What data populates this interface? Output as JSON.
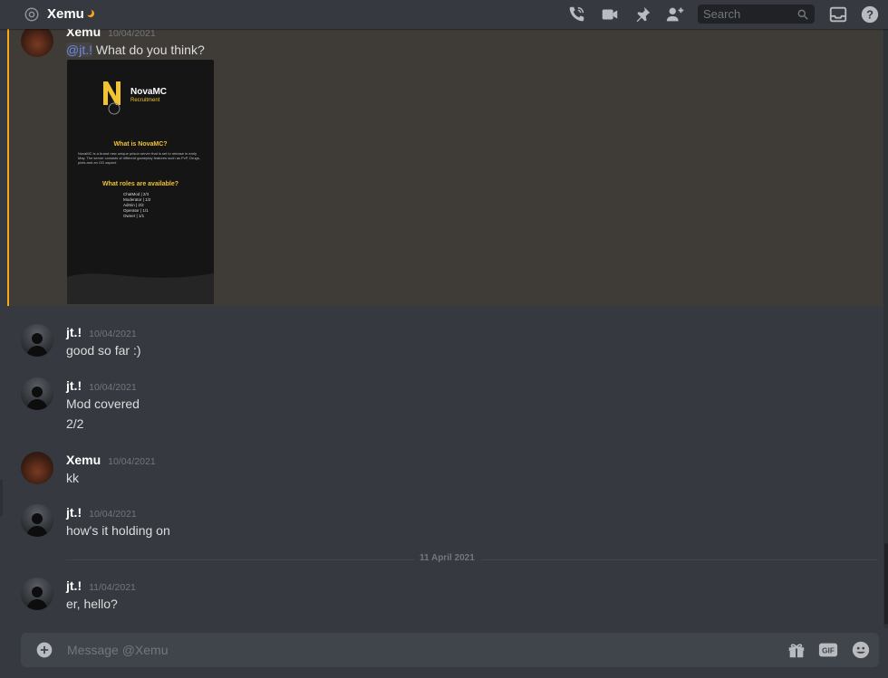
{
  "header": {
    "channel_name": "Xemu",
    "search_placeholder": "Search",
    "icons": [
      "at-icon",
      "moon-icon",
      "call-icon",
      "video-icon",
      "pin-icon",
      "add-friend-icon",
      "search-icon",
      "inbox-icon",
      "help-icon"
    ]
  },
  "messages": [
    {
      "author": "Xemu",
      "timestamp": "10/04/2021",
      "mention": "@jt.!",
      "text": " What do you think?"
    },
    {
      "author": "jt.!",
      "timestamp": "10/04/2021",
      "lines": [
        "good so far :)"
      ]
    },
    {
      "author": "jt.!",
      "timestamp": "10/04/2021",
      "lines": [
        "Mod covered",
        "2/2"
      ]
    },
    {
      "author": "Xemu",
      "timestamp": "10/04/2021",
      "lines": [
        "kk"
      ]
    },
    {
      "author": "jt.!",
      "timestamp": "10/04/2021",
      "lines": [
        "how's it holding on"
      ]
    },
    {
      "author": "jt.!",
      "timestamp": "11/04/2021",
      "lines": [
        "er, hello?"
      ]
    }
  ],
  "attachment": {
    "brand": "NovaMC",
    "brand_sub": "Recruitment",
    "heading1": "What is NovaMC?",
    "paragraph": "NovaMC is a brand new unique prison server that is set to release in early May. The server consists of different gameplay features such as PvP, Drugs, plots and an OG aspect.",
    "heading2": "What roles are available?",
    "roles": [
      "ChatMod | 2/3",
      "Moderator | 1/2",
      "Admin | 2/2",
      "Operator | 1/1",
      "Owner | 1/1"
    ]
  },
  "date_divider": "11 April 2021",
  "composer": {
    "placeholder": "Message @Xemu",
    "icons": [
      "plus-icon",
      "gift-icon",
      "gif-icon",
      "emoji-icon"
    ]
  },
  "colors": {
    "background": "#36393f",
    "mention": "#7289da",
    "accent": "#faa81a",
    "composer": "#40444b"
  }
}
